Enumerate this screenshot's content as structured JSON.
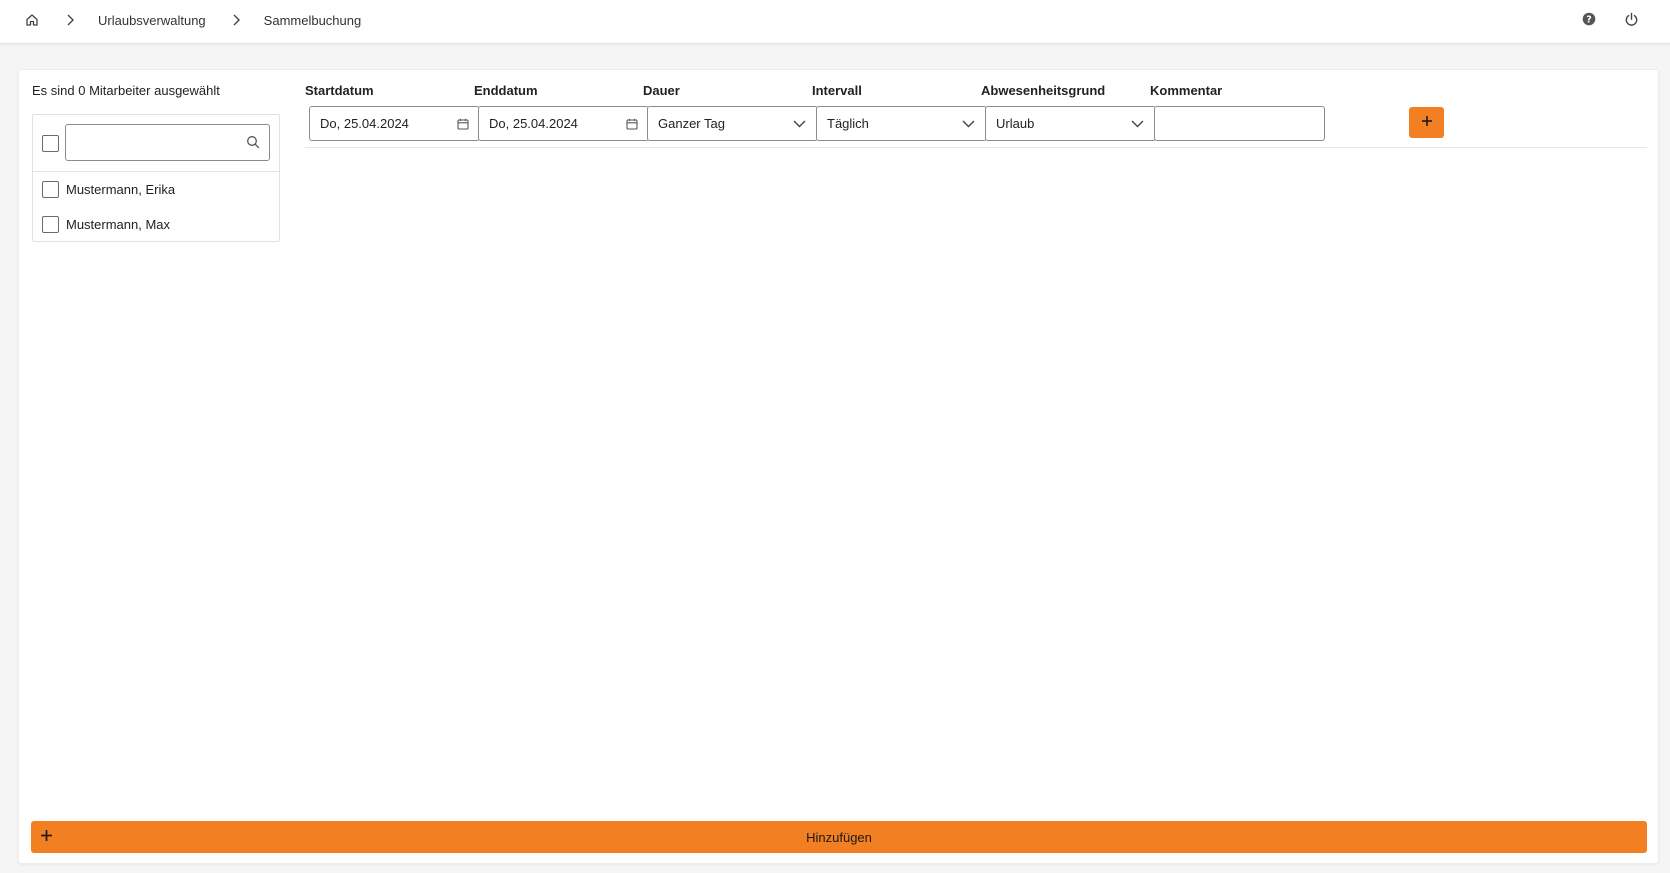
{
  "breadcrumb": {
    "home_icon": "home-icon",
    "items": [
      "Urlaubsverwaltung",
      "Sammelbuchung"
    ]
  },
  "header_actions": [
    {
      "icon": "help-icon"
    },
    {
      "icon": "power-icon"
    }
  ],
  "employees": {
    "selection_text": "Es sind 0 Mitarbeiter ausgewählt",
    "search": {
      "value": "",
      "placeholder": ""
    },
    "list": [
      {
        "name": "Mustermann, Erika",
        "checked": false
      },
      {
        "name": "Mustermann, Max",
        "checked": false
      }
    ]
  },
  "form": {
    "startdatum": {
      "label": "Startdatum",
      "value": "Do, 25.04.2024"
    },
    "enddatum": {
      "label": "Enddatum",
      "value": "Do, 25.04.2024"
    },
    "dauer": {
      "label": "Dauer",
      "value": "Ganzer Tag"
    },
    "intervall": {
      "label": "Intervall",
      "value": "Täglich"
    },
    "abwesenheitsgrund": {
      "label": "Abwesenheitsgrund",
      "value": "Urlaub"
    },
    "kommentar": {
      "label": "Kommentar",
      "value": ""
    }
  },
  "add_button": {
    "label": "Hinzufügen"
  },
  "colors": {
    "accent": "#f37f23",
    "border": "#8c8c8c"
  }
}
